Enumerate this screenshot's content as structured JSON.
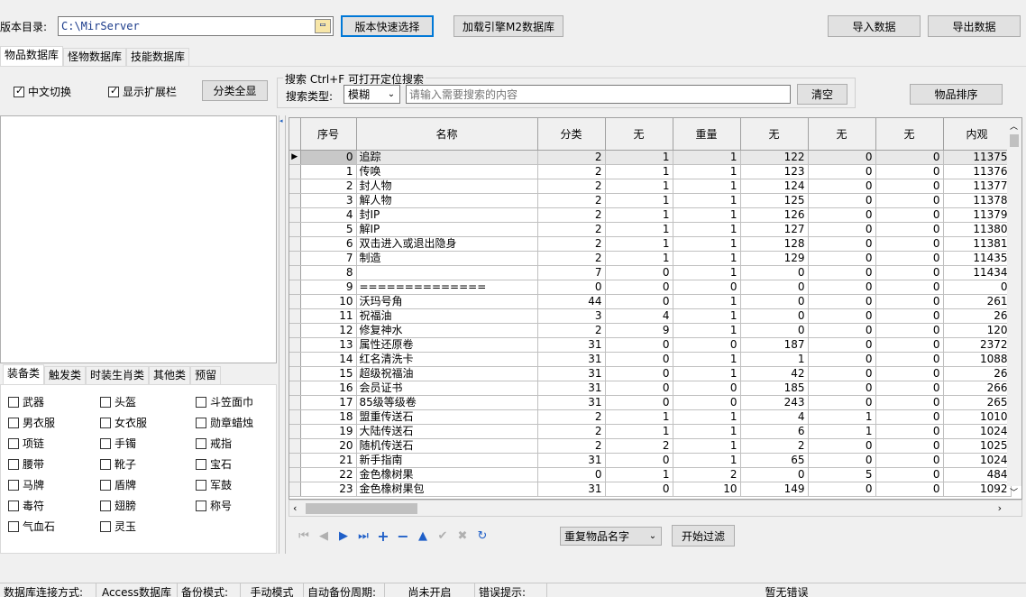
{
  "toolbar": {
    "dir_label": "版本目录:",
    "dir_value": "C:\\MirServer",
    "version_btn": "版本快速选择",
    "load_btn": "加载引擎M2数据库",
    "import_btn": "导入数据",
    "export_btn": "导出数据"
  },
  "tabs": [
    "物品数据库",
    "怪物数据库",
    "技能数据库"
  ],
  "options": {
    "chinese_toggle": "中文切换",
    "show_ext": "显示扩展栏",
    "expand_all": "分类全显"
  },
  "search": {
    "title": "搜索  Ctrl+F 可打开定位搜索",
    "type_label": "搜索类型:",
    "type_value": "模糊",
    "placeholder": "请输入需要搜索的内容",
    "clear_btn": "清空",
    "sort_btn": "物品排序"
  },
  "category_tabs": [
    "装备类",
    "触发类",
    "时装生肖类",
    "其他类",
    "预留"
  ],
  "categories": [
    [
      "武器",
      "头盔",
      "斗笠面巾"
    ],
    [
      "男衣服",
      "女衣服",
      "勋章蜡烛"
    ],
    [
      "项链",
      "手镯",
      "戒指"
    ],
    [
      "腰带",
      "靴子",
      "宝石"
    ],
    [
      "马牌",
      "盾牌",
      "军鼓"
    ],
    [
      "毒符",
      "翅膀",
      "称号"
    ],
    [
      "气血石",
      "灵玉",
      ""
    ]
  ],
  "grid": {
    "columns": [
      "序号",
      "名称",
      "分类",
      "无",
      "重量",
      "无",
      "无",
      "无",
      "内观"
    ],
    "rows": [
      [
        "0",
        "追踪",
        "2",
        "1",
        "1",
        "122",
        "0",
        "0",
        "11375"
      ],
      [
        "1",
        "传唤",
        "2",
        "1",
        "1",
        "123",
        "0",
        "0",
        "11376"
      ],
      [
        "2",
        "封人物",
        "2",
        "1",
        "1",
        "124",
        "0",
        "0",
        "11377"
      ],
      [
        "3",
        "解人物",
        "2",
        "1",
        "1",
        "125",
        "0",
        "0",
        "11378"
      ],
      [
        "4",
        "封IP",
        "2",
        "1",
        "1",
        "126",
        "0",
        "0",
        "11379"
      ],
      [
        "5",
        "解IP",
        "2",
        "1",
        "1",
        "127",
        "0",
        "0",
        "11380"
      ],
      [
        "6",
        "双击进入或退出隐身",
        "2",
        "1",
        "1",
        "128",
        "0",
        "0",
        "11381"
      ],
      [
        "7",
        "制造",
        "2",
        "1",
        "1",
        "129",
        "0",
        "0",
        "11435"
      ],
      [
        "8",
        "",
        "7",
        "0",
        "1",
        "0",
        "0",
        "0",
        "11434"
      ],
      [
        "9",
        "==============",
        "0",
        "0",
        "0",
        "0",
        "0",
        "0",
        "0"
      ],
      [
        "10",
        "沃玛号角",
        "44",
        "0",
        "1",
        "0",
        "0",
        "0",
        "261"
      ],
      [
        "11",
        "祝福油",
        "3",
        "4",
        "1",
        "0",
        "0",
        "0",
        "26"
      ],
      [
        "12",
        "修复神水",
        "2",
        "9",
        "1",
        "0",
        "0",
        "0",
        "120"
      ],
      [
        "13",
        "属性还原卷",
        "31",
        "0",
        "0",
        "187",
        "0",
        "0",
        "2372"
      ],
      [
        "14",
        "红名清洗卡",
        "31",
        "0",
        "1",
        "1",
        "0",
        "0",
        "1088"
      ],
      [
        "15",
        "超级祝福油",
        "31",
        "0",
        "1",
        "42",
        "0",
        "0",
        "26"
      ],
      [
        "16",
        "会员证书",
        "31",
        "0",
        "0",
        "185",
        "0",
        "0",
        "266"
      ],
      [
        "17",
        "85级等级卷",
        "31",
        "0",
        "0",
        "243",
        "0",
        "0",
        "265"
      ],
      [
        "18",
        "盟重传送石",
        "2",
        "1",
        "1",
        "4",
        "1",
        "0",
        "1010"
      ],
      [
        "19",
        "大陆传送石",
        "2",
        "1",
        "1",
        "6",
        "1",
        "0",
        "1024"
      ],
      [
        "20",
        "随机传送石",
        "2",
        "2",
        "1",
        "2",
        "0",
        "0",
        "1025"
      ],
      [
        "21",
        "新手指南",
        "31",
        "0",
        "1",
        "65",
        "0",
        "0",
        "1024"
      ],
      [
        "22",
        "金色橡树果",
        "0",
        "1",
        "2",
        "0",
        "5",
        "0",
        "484"
      ],
      [
        "23",
        "金色橡树果包",
        "31",
        "0",
        "10",
        "149",
        "0",
        "0",
        "1092"
      ]
    ]
  },
  "bottom": {
    "filter_value": "重复物品名字",
    "filter_btn": "开始过滤"
  },
  "statusbar": [
    "数据库连接方式:",
    "Access数据库",
    "备份模式:",
    "手动模式",
    "自动备份周期:",
    "尚未开启",
    "错误提示:",
    "暂无错误"
  ]
}
